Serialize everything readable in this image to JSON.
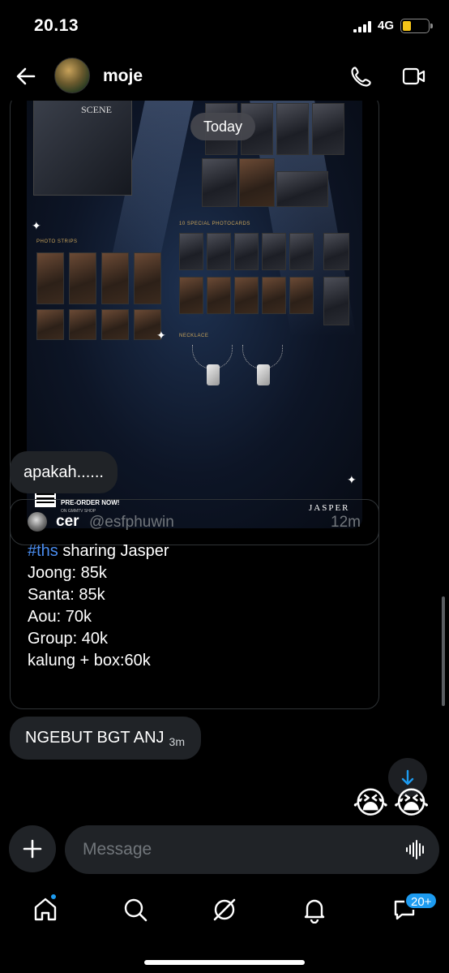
{
  "status_bar": {
    "time": "20.13",
    "network": "4G",
    "battery_level": 0.34
  },
  "header": {
    "contact_name": "moje"
  },
  "media": {
    "title": "SCENE",
    "labels": [
      "10 SPECIAL PHOTOCARDS",
      "NECKLACE",
      "PHOTO STRIPS"
    ],
    "preorder": "PRE-ORDER NOW!",
    "preorder_sub": "ON GMMTV SHOP",
    "brand": "JASPER"
  },
  "today_label": "Today",
  "messages": {
    "first": "apakah......",
    "second": "NGEBUT BGT ANJ",
    "second_time": "3m",
    "reactions": "😭😭"
  },
  "quote": {
    "name": "cer",
    "handle": "@esfphuwin",
    "time": "12m",
    "hashtag": "#ths",
    "first_line_rest": " sharing Jasper",
    "body": "\nJoong: 85k\nSanta: 85k\nAou: 70k\nGroup: 40k\nkalung + box:60k"
  },
  "composer": {
    "placeholder": "Message"
  },
  "nav": {
    "badge": "20+"
  },
  "colors": {
    "accent": "#1d9bf0",
    "hashtag": "#4a8df0",
    "bubble": "#202327",
    "muted": "#71767b"
  },
  "icons": [
    "back-icon",
    "phone-icon",
    "video-icon",
    "plus-icon",
    "voice-icon",
    "arrow-down-icon",
    "home-icon",
    "search-icon",
    "grok-icon",
    "bell-icon",
    "messages-icon"
  ]
}
